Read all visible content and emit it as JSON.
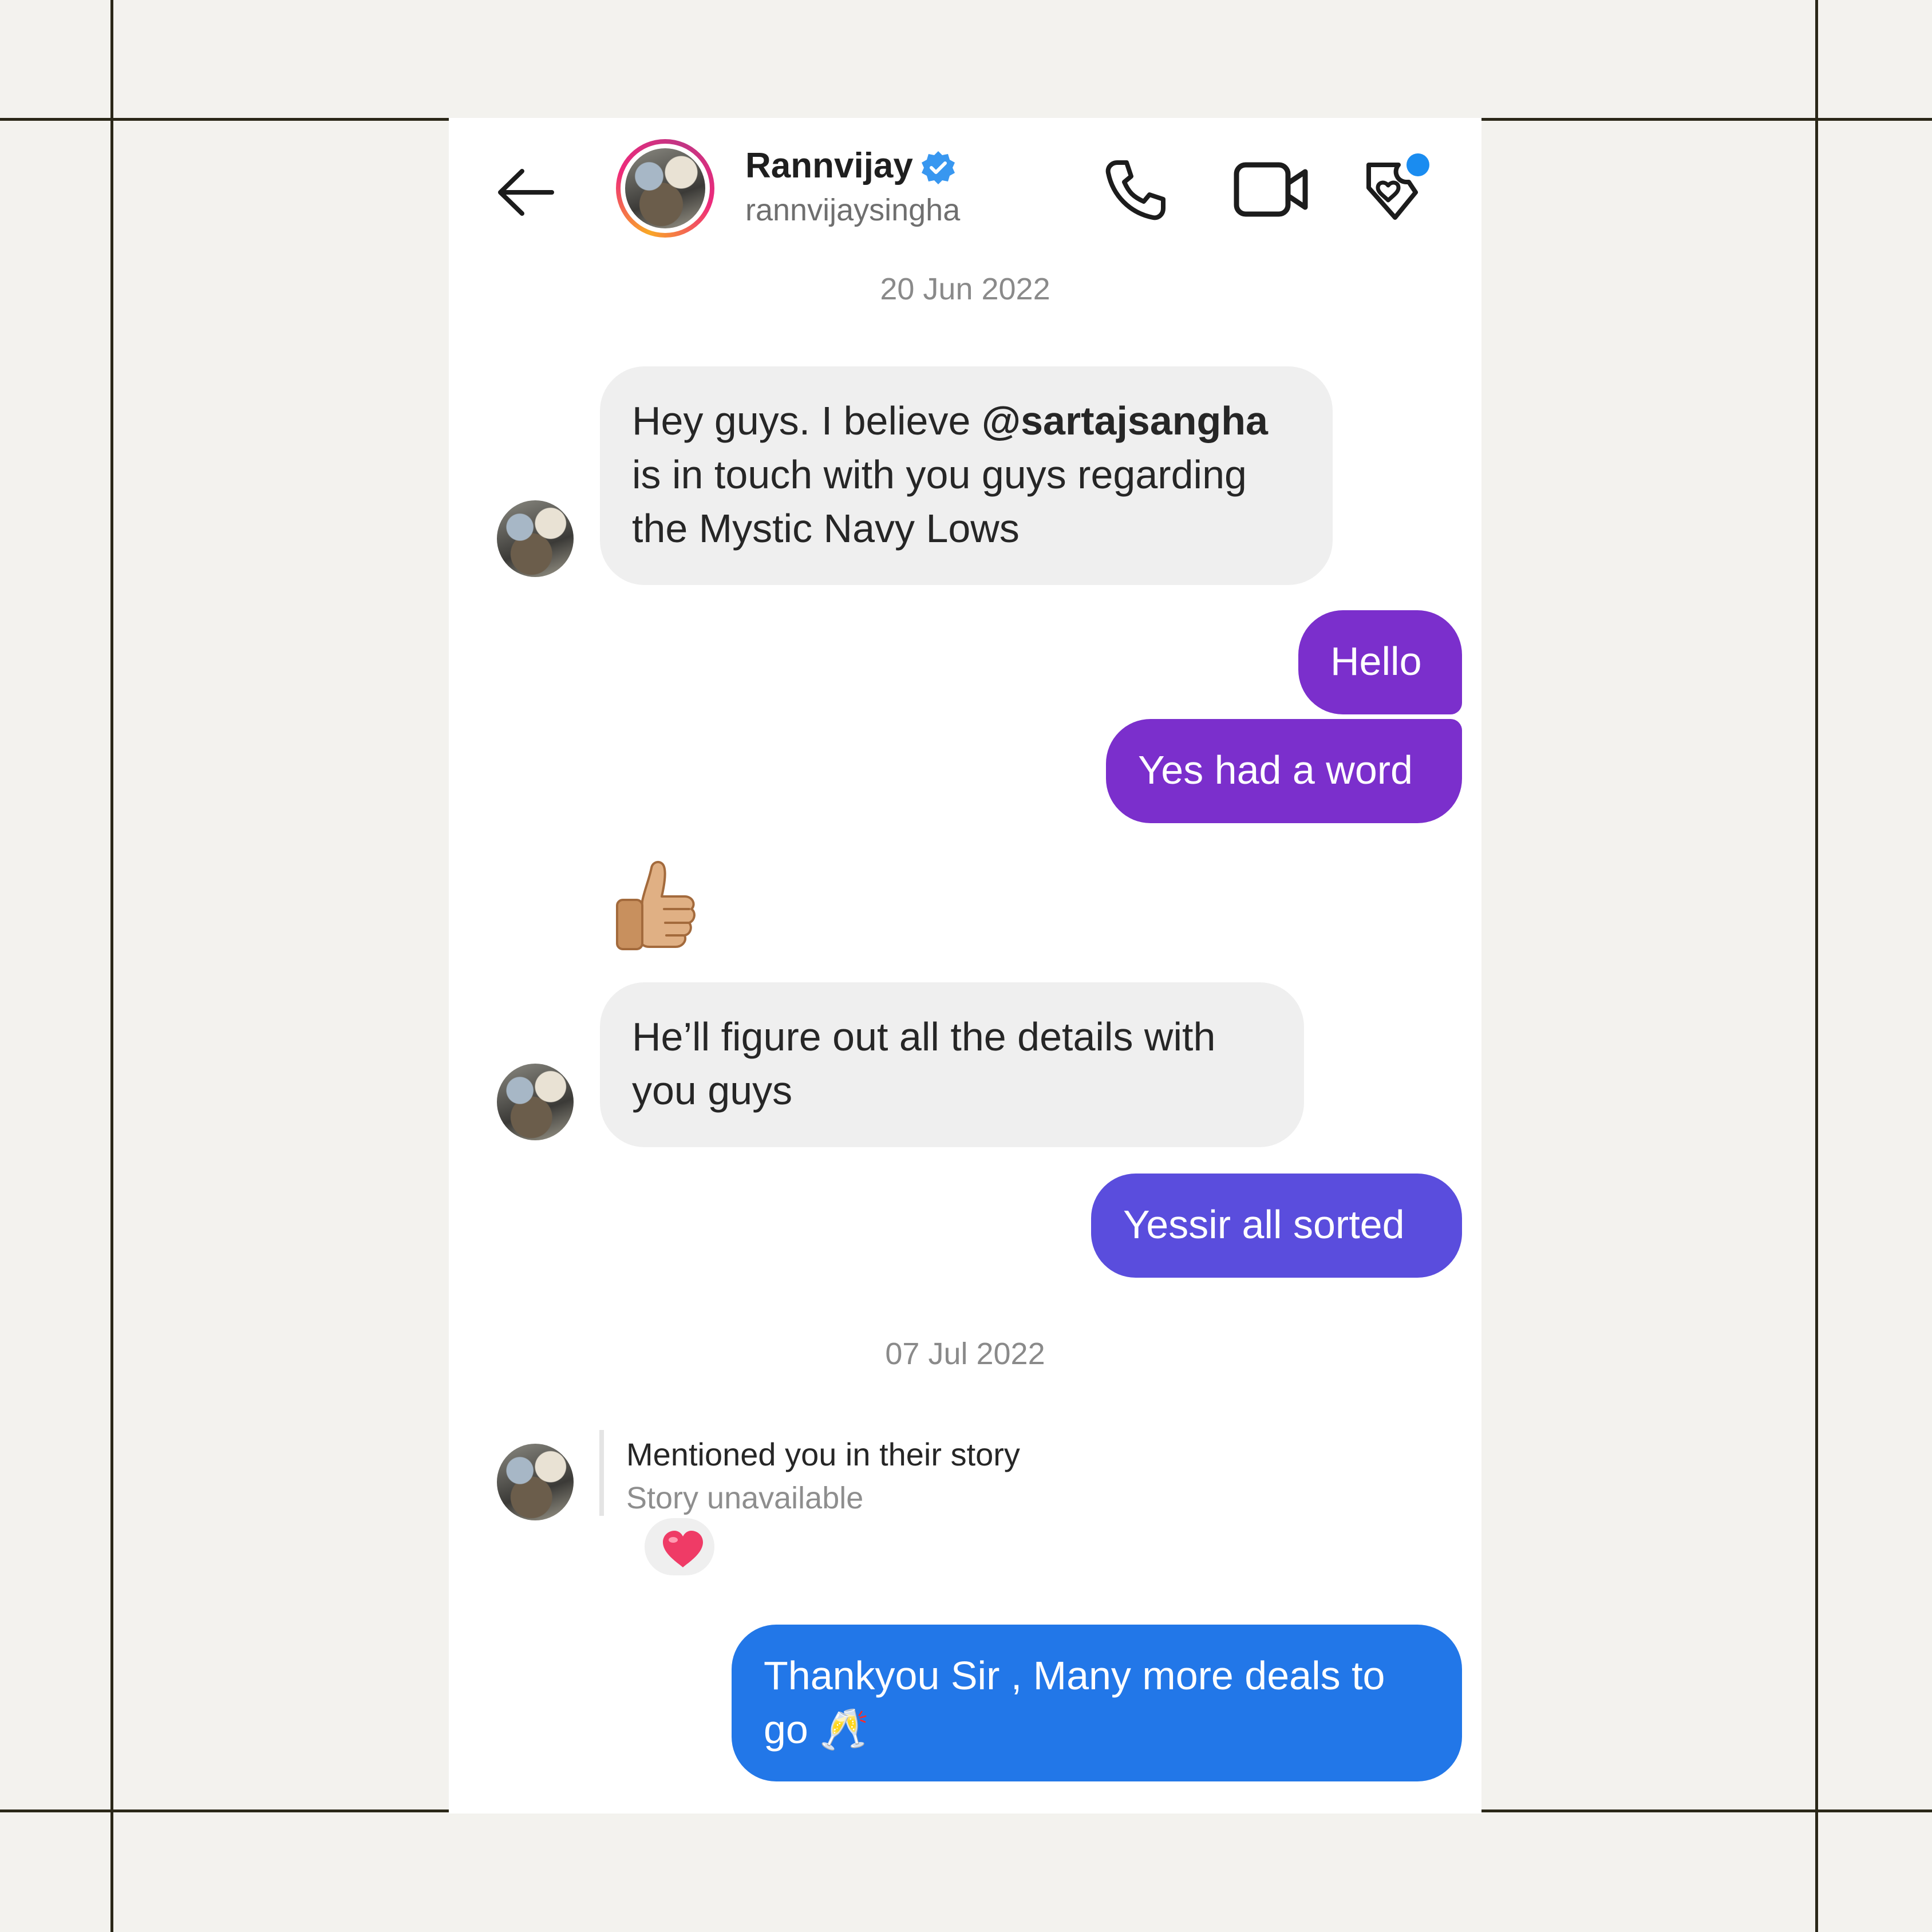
{
  "header": {
    "back_label": "back",
    "name": "Rannvijay",
    "handle": "rannvijaysingha"
  },
  "conversation": {
    "dates": [
      "20 Jun 2022",
      "07 Jul 2022"
    ],
    "msg1": {
      "pre": "Hey guys. I believe ",
      "mention": "@sartajsangha",
      "post": " is in touch with you guys regarding the Mystic Navy Lows"
    },
    "msg2": "Hello",
    "msg3": "Yes had a word",
    "msg4": "👍🏼",
    "msg5": "He’ll figure out all the details with you guys",
    "msg6": "Yessir all sorted",
    "story": {
      "title": "Mentioned you in their story",
      "status": "Story unavailable",
      "reaction": "❤️"
    },
    "msg7": "Thankyou Sir , Many more deals to go 🥂"
  },
  "colors": {
    "bubble_purple": "#7b2fcc",
    "bubble_indigo": "#5a4ddd",
    "bubble_blue": "#2277e8",
    "bubble_incoming": "#efefef",
    "verified_blue": "#3897f0",
    "notification_dot": "#1a8cf0"
  },
  "icons": [
    "back-arrow-icon",
    "verified-badge-icon",
    "phone-call-icon",
    "video-camera-icon",
    "heart-tag-icon",
    "thumbs-up-emoji",
    "heart-reaction-icon",
    "clinking-glasses-emoji"
  ]
}
